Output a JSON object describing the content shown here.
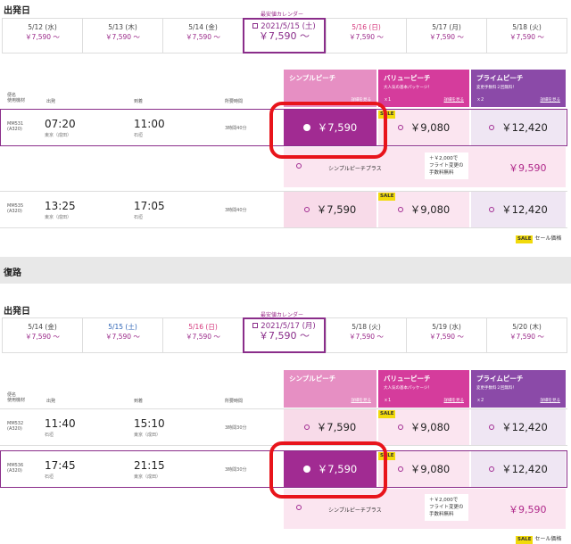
{
  "outbound": {
    "section_label": "出発日",
    "calendar_caption": "最安値カレンダー",
    "calendar": [
      {
        "date": "5/12 (水)",
        "price": "￥7,590 ～",
        "kind": "wd"
      },
      {
        "date": "5/13 (木)",
        "price": "￥7,590 ～",
        "kind": "wd"
      },
      {
        "date": "5/14 (金)",
        "price": "￥7,590 ～",
        "kind": "wd"
      },
      {
        "date": "2021/5/15 (土)",
        "price": "￥7,590 ～",
        "kind": "sel"
      },
      {
        "date": "5/16 (日)",
        "price": "￥7,590 ～",
        "kind": "hol"
      },
      {
        "date": "5/17 (月)",
        "price": "￥7,590 ～",
        "kind": "wd"
      },
      {
        "date": "5/18 (火)",
        "price": "￥7,590 ～",
        "kind": "wd"
      }
    ],
    "flights": [
      {
        "flight": "MM531",
        "aircraft": "(A320)",
        "dep": "07:20",
        "dep_city": "東京（成田）",
        "arr": "11:00",
        "arr_city": "石垣",
        "duration": "3時間40分",
        "simple": "￥7,590",
        "value": "￥9,080",
        "prime": "￥12,420"
      },
      {
        "flight": "MM535",
        "aircraft": "(A320)",
        "dep": "13:25",
        "dep_city": "東京（成田）",
        "arr": "17:05",
        "arr_city": "石垣",
        "duration": "3時間40分",
        "simple": "￥7,590",
        "value": "￥9,080",
        "prime": "￥12,420"
      }
    ]
  },
  "return": {
    "section_title": "復路",
    "section_label": "出発日",
    "calendar_caption": "最安値カレンダー",
    "calendar": [
      {
        "date": "5/14 (金)",
        "price": "￥7,590 ～",
        "kind": "wd"
      },
      {
        "date": "5/15 (土)",
        "price": "￥7,590 ～",
        "kind": "sat"
      },
      {
        "date": "5/16 (日)",
        "price": "￥7,590 ～",
        "kind": "hol"
      },
      {
        "date": "2021/5/17 (月)",
        "price": "￥7,590 ～",
        "kind": "sel"
      },
      {
        "date": "5/18 (火)",
        "price": "￥7,590 ～",
        "kind": "wd"
      },
      {
        "date": "5/19 (水)",
        "price": "￥7,590 ～",
        "kind": "wd"
      },
      {
        "date": "5/20 (木)",
        "price": "￥7,590 ～",
        "kind": "wd"
      }
    ],
    "flights": [
      {
        "flight": "MM532",
        "aircraft": "(A320)",
        "dep": "11:40",
        "dep_city": "石垣",
        "arr": "15:10",
        "arr_city": "東京（成田）",
        "duration": "3時間30分",
        "simple": "￥7,590",
        "value": "￥9,080",
        "prime": "￥12,420"
      },
      {
        "flight": "MM536",
        "aircraft": "(A320)",
        "dep": "17:45",
        "dep_city": "石垣",
        "arr": "21:15",
        "arr_city": "東京（成田）",
        "duration": "3時間30分",
        "simple": "￥7,590",
        "value": "￥9,080",
        "prime": "￥12,420"
      }
    ]
  },
  "fares": {
    "simple": {
      "title": "シンプルピーチ",
      "detail": "詳細を見る"
    },
    "value": {
      "title": "バリューピーチ",
      "subtitle": "大人気の基本パッケージ！",
      "detail": "詳細を見る",
      "count": "ｘ1"
    },
    "prime": {
      "title": "プライムピーチ",
      "subtitle": "変更手数料２回無料！",
      "detail": "詳細を見る",
      "count": "ｘ2"
    }
  },
  "columns": {
    "flight": "便名\n使用機材",
    "dep": "出発",
    "arr": "到着",
    "duration": "所要時間"
  },
  "plus": {
    "label": "シンプルピーチプラス",
    "note": "＋￥2,000で\nフライト変更の\n手数料無料",
    "price": "￥9,590"
  },
  "sale_badge": "SALE",
  "legend_text": "セール価格"
}
